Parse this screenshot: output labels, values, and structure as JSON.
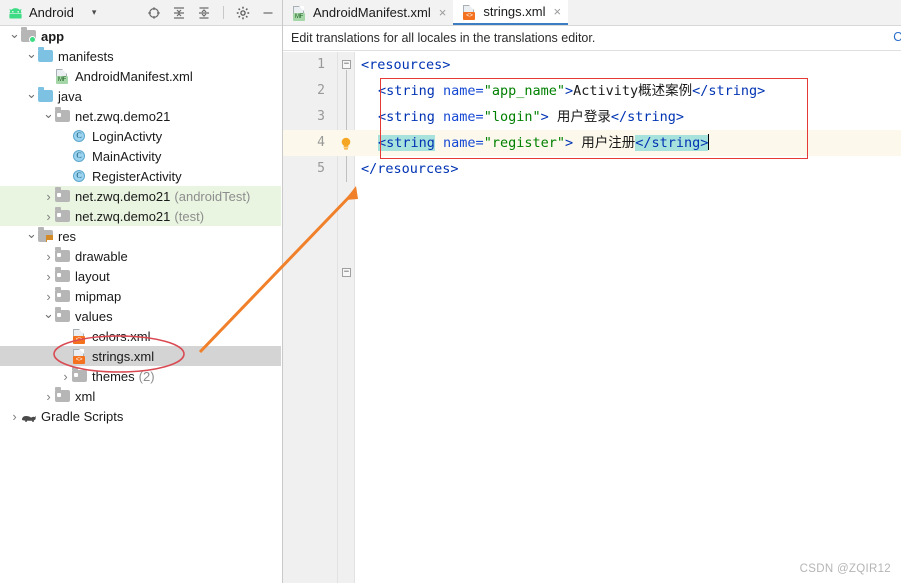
{
  "app": {
    "watermark": "CSDN @ZQIR12"
  },
  "project_panel": {
    "title": "Android",
    "caret": "▾",
    "icons": [
      {
        "name": "locate-icon",
        "glyph": "⊕"
      },
      {
        "name": "expand-all-icon",
        "glyph": "≡"
      },
      {
        "name": "collapse-all-icon",
        "glyph": "≡"
      },
      {
        "name": "settings-gear-icon",
        "glyph": "⚙"
      },
      {
        "name": "minimize-icon",
        "glyph": "—"
      }
    ],
    "tree": [
      {
        "label": "app",
        "icon": "folder-app",
        "indent": 0,
        "twisty": "down",
        "bold": true,
        "selected": false,
        "suffix": ""
      },
      {
        "label": "manifests",
        "icon": "folder-blue",
        "indent": 1,
        "twisty": "down",
        "bold": false,
        "selected": false,
        "suffix": ""
      },
      {
        "label": "AndroidManifest.xml",
        "icon": "file-manifest",
        "indent": 2,
        "twisty": "blank",
        "bold": false,
        "selected": false,
        "suffix": ""
      },
      {
        "label": "java",
        "icon": "folder-blue",
        "indent": 1,
        "twisty": "down",
        "bold": false,
        "selected": false,
        "suffix": ""
      },
      {
        "label": "net.zwq.demo21",
        "icon": "folder-package",
        "indent": 2,
        "twisty": "down",
        "bold": false,
        "selected": false,
        "suffix": ""
      },
      {
        "label": "LoginActivty",
        "icon": "class",
        "indent": 3,
        "twisty": "blank",
        "bold": false,
        "selected": false,
        "suffix": ""
      },
      {
        "label": "MainActivity",
        "icon": "class",
        "indent": 3,
        "twisty": "blank",
        "bold": false,
        "selected": false,
        "suffix": ""
      },
      {
        "label": "RegisterActivity",
        "icon": "class",
        "indent": 3,
        "twisty": "blank",
        "bold": false,
        "selected": false,
        "suffix": ""
      },
      {
        "label": "net.zwq.demo21",
        "icon": "folder-package",
        "indent": 2,
        "twisty": "right",
        "bold": false,
        "selected": false,
        "suffix": "(androidTest)",
        "green": true
      },
      {
        "label": "net.zwq.demo21",
        "icon": "folder-package",
        "indent": 2,
        "twisty": "right",
        "bold": false,
        "selected": false,
        "suffix": "(test)",
        "green": true
      },
      {
        "label": "res",
        "icon": "folder-res",
        "indent": 1,
        "twisty": "down",
        "bold": false,
        "selected": false,
        "suffix": ""
      },
      {
        "label": "drawable",
        "icon": "folder-package",
        "indent": 2,
        "twisty": "right",
        "bold": false,
        "selected": false,
        "suffix": ""
      },
      {
        "label": "layout",
        "icon": "folder-package",
        "indent": 2,
        "twisty": "right",
        "bold": false,
        "selected": false,
        "suffix": ""
      },
      {
        "label": "mipmap",
        "icon": "folder-package",
        "indent": 2,
        "twisty": "right",
        "bold": false,
        "selected": false,
        "suffix": ""
      },
      {
        "label": "values",
        "icon": "folder-package",
        "indent": 2,
        "twisty": "down",
        "bold": false,
        "selected": false,
        "suffix": ""
      },
      {
        "label": "colors.xml",
        "icon": "file-xml",
        "indent": 3,
        "twisty": "blank",
        "bold": false,
        "selected": false,
        "suffix": ""
      },
      {
        "label": "strings.xml",
        "icon": "file-xml",
        "indent": 3,
        "twisty": "blank",
        "bold": false,
        "selected": true,
        "suffix": ""
      },
      {
        "label": "themes",
        "icon": "folder-package",
        "indent": 3,
        "twisty": "right",
        "bold": false,
        "selected": false,
        "suffix": "(2)"
      },
      {
        "label": "xml",
        "icon": "folder-package",
        "indent": 2,
        "twisty": "right",
        "bold": false,
        "selected": false,
        "suffix": ""
      },
      {
        "label": "Gradle Scripts",
        "icon": "gradle",
        "indent": 0,
        "twisty": "right",
        "bold": false,
        "selected": false,
        "suffix": ""
      }
    ]
  },
  "editor": {
    "tabs": [
      {
        "label": "AndroidManifest.xml",
        "icon": "file-manifest",
        "active": false,
        "close": "×"
      },
      {
        "label": "strings.xml",
        "icon": "file-xml",
        "active": true,
        "close": "×"
      }
    ],
    "notification": {
      "message": "Edit translations for all locales in the translations editor.",
      "link": "O"
    },
    "lines": [
      {
        "num": "1",
        "fold": "open",
        "current": false,
        "bulb": false
      },
      {
        "num": "2",
        "fold": "",
        "current": false,
        "bulb": false
      },
      {
        "num": "3",
        "fold": "",
        "current": false,
        "bulb": false
      },
      {
        "num": "4",
        "fold": "",
        "current": true,
        "bulb": true
      },
      {
        "num": "5",
        "fold": "close",
        "current": false,
        "bulb": false
      }
    ],
    "code": {
      "line1_open": "<resources>",
      "line2_tag_open": "<string",
      "line2_attr": " name=",
      "line2_value": "\"app_name\"",
      "line2_gt": ">",
      "line2_text": "Activity概述案例",
      "line2_tag_close": "</string>",
      "line3_tag_open": "<string",
      "line3_attr": " name=",
      "line3_value": "\"login\"",
      "line3_gt": ">",
      "line3_text": " 用户登录",
      "line3_tag_close": "</string>",
      "line4_tag_open": "<string",
      "line4_attr": " name=",
      "line4_value": "\"register\"",
      "line4_gt": ">",
      "line4_text": " 用户注册",
      "line4_tag_close": "</string>",
      "line5_close": "</resources>"
    }
  }
}
